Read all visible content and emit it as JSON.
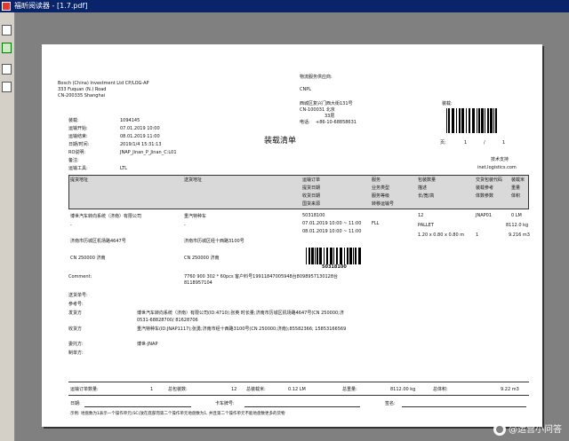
{
  "window": {
    "title": "福昕阅读器 - [1.7.pdf]"
  },
  "sidebar": {
    "icons": [
      "pages-icon",
      "bookmark-icon",
      "comments-icon",
      "attachment-icon"
    ]
  },
  "doc": {
    "company": {
      "line1": "Bosch (China) Investment Ltd CP/LOG-AP",
      "line2": "333 Fuquan (N.) Road",
      "line3": "CN-200335 Shanghai"
    },
    "provider": {
      "label": "物流服务供应商:",
      "name": "CNPL",
      "addr1": "西城区复兴门西大街131号",
      "addr2": "CN-100031 北京",
      "floor": "33层",
      "tel_label": "电话:",
      "tel": "+86-10-68858631"
    },
    "shipment_label": "装载:",
    "fields": [
      {
        "label": "装载:",
        "value": "1094145"
      },
      {
        "label": "运输开始:",
        "value": "07.01.2019 10:00"
      },
      {
        "label": "运输结束:",
        "value": "08.01.2019 11:00"
      },
      {
        "label": "日期/时间:",
        "value": "2019/1/4 15:31:13"
      },
      {
        "label": "RO说明:",
        "value": "JNAP_Jinan_P_Jinan_C:L01"
      },
      {
        "label": "备注:",
        "value": ""
      },
      {
        "label": "运输工具:",
        "value": "LTL"
      }
    ],
    "doc_title": "装载清单",
    "page_label": "页:",
    "page_current": "1",
    "page_sep": "/",
    "page_total": "1",
    "support_label": "技术支持",
    "support_site": "inet.logistics.com",
    "header": {
      "c1": "提货地址",
      "c2": "送货地址",
      "c3": [
        "运输订单",
        "提货日期",
        "收货日期",
        "国货来源"
      ],
      "c4": [
        "服务",
        "业务类型",
        "服务等级",
        "转移运输号"
      ],
      "c5": [
        "包装数量",
        "描述",
        "长/宽/高"
      ],
      "c6": [
        "交货包装代码",
        "装载参考",
        "体数参数"
      ],
      "c7": [
        "装载米",
        "重量",
        "体积"
      ]
    },
    "row": {
      "pickup_name": "博世汽车转向系统（济南）有限公司",
      "pickup_dash": "-",
      "pickup_addr": "济南市历城区机场路4647号",
      "pickup_city": "CN 250000 济南",
      "delivery_name": "重汽特种车",
      "delivery_dash": "-",
      "delivery_addr": "济南市历城区经十西路3100号",
      "delivery_city": "CN 250000 济南",
      "order": "50318100",
      "pickup_date": "07.01.2019 10:00 ~ 11:00",
      "delivery_date": "08.01.2019 10:00 ~ 11:00",
      "service": "FLL",
      "pkg_qty": "12",
      "pkg_type": "PALLET",
      "dims": "1.20 x 0.80 x 0.80 m",
      "pkg_code": "JNAP01",
      "ref_qty": "1",
      "ldm": "0 LM",
      "weight": "8112.0 kg",
      "volume": "9.216 m3"
    },
    "barcode_number": "50318100",
    "comment_label": "Comment:",
    "comment_line1": "7760 900 302 *  60pcs  客户料号19911847005948台8098957130128台",
    "comment_line2": "8118957104",
    "misc": [
      {
        "label": "送货单号:",
        "value": ""
      },
      {
        "label": "参考号:",
        "value": ""
      },
      {
        "label": "发货方",
        "value": "博世汽车转向系统（济南）有限公司(ID:4710);张英 时长量;济南市历城区机场路4647号(CN 250000;济"
      },
      {
        "label": "",
        "value": "0531-68828700/ 81628706"
      },
      {
        "label": "收货方",
        "value": "重汽特种车(ID:JNAP1117);张勇;济南市经十西路3100号(CN 250000;济南);85582366; 15853166569"
      },
      {
        "label": "委托方:",
        "value": "博世-JNAP"
      },
      {
        "label": "制单方:",
        "value": ""
      }
    ],
    "totals": {
      "orders_label": "运输订单数量:",
      "orders_value": "1",
      "pallets_label": "总包装数:",
      "pallets_value": "12",
      "ldm_label": "总装载米:",
      "ldm_value": "0.12 LM",
      "weight_label": "总重量:",
      "weight_value": "8112.00 kg",
      "volume_label": "总体积:",
      "volume_value": "9.22 m3"
    },
    "sign": {
      "date_label": "日期:",
      "truck_label": "卡车牌号:",
      "signature_label": "签名:"
    },
    "footnote": "示例: 地盘数为1表示一个操作单元(SC)放在底部而第二个操作单元地盘数为1, 并且第二个操作单元不能地盘数更多的货物"
  },
  "watermark": {
    "text": "@运营小问答"
  }
}
